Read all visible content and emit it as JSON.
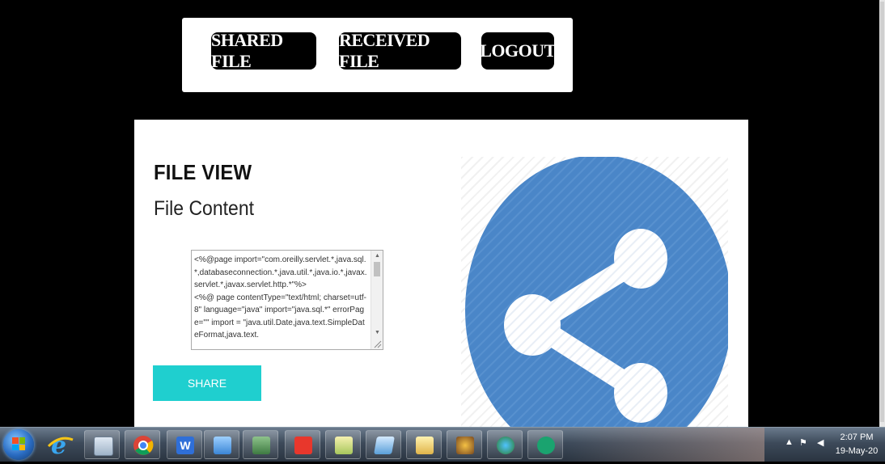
{
  "nav": {
    "shared_file": "SHARED FILE",
    "received_file": "RECEIVED FILE",
    "logout": "LOGOUT"
  },
  "card": {
    "title": "FILE VIEW",
    "subtitle": "File Content",
    "file_content": "<%@page import=\"com.oreilly.servlet.*,java.sql.*,databaseconnection.*,java.util.*,java.io.*,javax.servlet.*,javax.servlet.http.*\"%>\n<%@ page contentType=\"text/html; charset=utf-8\" language=\"java\" import=\"java.sql.*\" errorPage=\"\" import = \"java.util.Date,java.text.SimpleDateFormat,java.text.",
    "share_label": "SHARE"
  },
  "colors": {
    "share_button": "#1fcfcf",
    "share_icon_circle": "#4a86c8"
  },
  "taskbar": {
    "icons": [
      "windows-start-icon",
      "internet-explorer-icon",
      "calculator-icon",
      "chrome-icon",
      "wps-writer-icon",
      "control-panel-icon",
      "network-icon",
      "anydesk-icon",
      "notepad-icon",
      "tablet-icon",
      "file-explorer-icon",
      "java-ee-icon",
      "bluetooth-icon",
      "shield-icon"
    ],
    "time": "2:07 PM",
    "date": "19-May-20"
  }
}
